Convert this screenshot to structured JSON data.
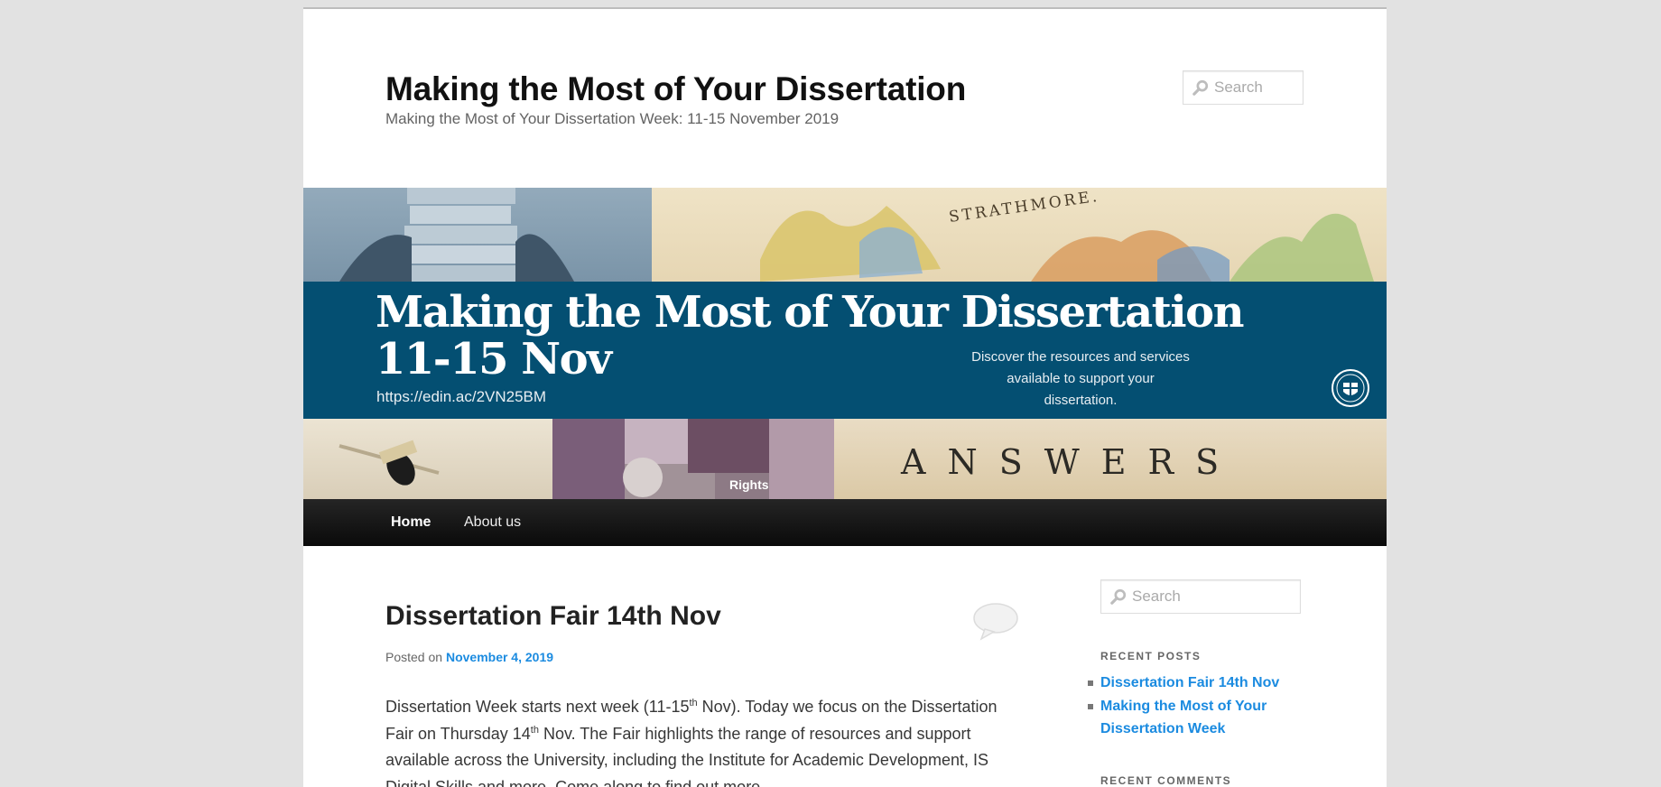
{
  "header": {
    "site_title": "Making the Most of Your Dissertation",
    "site_description": "Making the Most of Your Dissertation Week: 11-15 November 2019",
    "search_placeholder": "Search"
  },
  "banner": {
    "title": "Making the Most of Your Dissertation",
    "dates": "11-15 Nov",
    "url": "https://edin.ac/2VN25BM",
    "blurb": "Discover the resources and services available to support your dissertation.",
    "answers_text": "ANSWERS",
    "band_color": "#044f72"
  },
  "nav": {
    "items": [
      {
        "label": "Home"
      },
      {
        "label": "About us"
      }
    ]
  },
  "post": {
    "title": "Dissertation Fair 14th Nov",
    "posted_on_label": "Posted on",
    "date": "November 4, 2019",
    "body": {
      "p1": "Dissertation Week starts next week (11-15",
      "sup1": "th",
      "p2": " Nov).  Today we focus on the Dissertation Fair on Thursday 14",
      "sup2": "th",
      "p3": " Nov. The Fair highlights the range of resources and support available across the University, including the Institute for Academic Development, IS Digital Skills and more. Come along to find out more."
    }
  },
  "sidebar": {
    "search_placeholder": "Search",
    "recent_posts_title": "RECENT POSTS",
    "recent_posts": [
      {
        "label": "Dissertation Fair 14th Nov"
      },
      {
        "label": "Making the Most of Your Dissertation Week"
      }
    ],
    "recent_comments_title": "RECENT COMMENTS"
  },
  "colors": {
    "link": "#1b8be0",
    "nav_bg": "#111111",
    "page_bg": "#e2e2e2"
  }
}
